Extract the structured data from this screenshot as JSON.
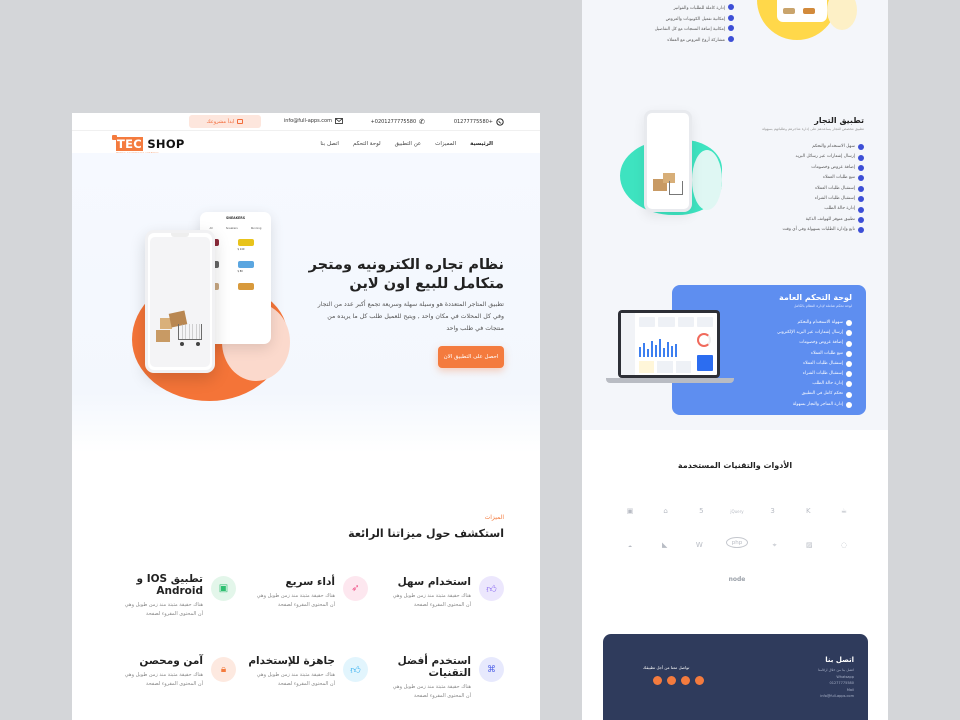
{
  "left": {
    "topbar": {
      "whatsapp": "01277775580+",
      "phone": "+0201277775580",
      "email": "info@full-apps.com",
      "apply_badge": "ابدأ مشروعك"
    },
    "logo": {
      "main": "TEC SHOP",
      "tag": "Online ecommerce solutions"
    },
    "nav": [
      "الرئيسية",
      "المميزات",
      "عن التطبيق",
      "لوحة التحكم",
      "اتصل بنا"
    ],
    "hero": {
      "title_line1": "نظام تجاره الكترونيه ومتجر",
      "title_line2": "متكامل للبيع اون لاين",
      "desc_line1": "تطبيق المتاجر المتعددة هو وسيلة سهلة وسريعة تجمع أكبر عدد من التجار",
      "desc_line2": "وفي كل المحلات في مكان واحد , ويتيح للعميل طلب كل ما يريده من",
      "desc_line3": "منتجات في طلب واحد",
      "cta": "احصل على التطبيق الان"
    },
    "phone_app": {
      "title": "SNEAKERS",
      "tabs": [
        "All",
        "Sneakers",
        "Running"
      ],
      "prices": [
        "$ 180",
        "$ 140",
        "$ 150",
        "$ 80"
      ]
    },
    "features": {
      "kicker": "الميزات",
      "title": "استكشف حول ميزاتنا الرائعة",
      "desc1": "هناك حقيقة مثبتة منذ زمن طويل وهي",
      "desc2": "أن المحتوى المقروء لصفحة",
      "items": [
        {
          "title": "استخدام سهل",
          "icon": "thumbs-up-icon"
        },
        {
          "title": "أداء سريع",
          "icon": "rocket-icon"
        },
        {
          "title_l1": "تطبيق IOS و",
          "title_l2": "Android",
          "icon": "android-icon"
        },
        {
          "title_l1": "استخدم أفضل",
          "title_l2": "التقنيات",
          "icon": "code-icon"
        },
        {
          "title": "جاهزة للإستخدام",
          "icon": "like-icon"
        },
        {
          "title": "آمن ومحصن",
          "icon": "lock-icon"
        }
      ]
    }
  },
  "right": {
    "top_list": [
      "إدارة كاملة للطلبات والفواتير",
      "إمكانية تفعيل الكوبونات والعروض",
      "إمكانية إضافة المنتجات مع كل التفاصيل",
      "مشاركة أروع العروض مع العملاء"
    ],
    "merchant": {
      "title": "تطبيق التجار",
      "subtitle": "تطبيق مخصص للتجار يساعدهم على إدارة متاجرهم وطلباتهم بسهولة",
      "items": [
        "سهل الاستخدام والتحكم",
        "إرسال إشعارات عبر رسائل البريد",
        "إضافة عروض وخصومات",
        "تتبع طلبات العملاء",
        "إستقبال طلبات العملاء",
        "إستقبال طلبات الشراء",
        "إدارة حالة الطلب",
        "تطبيق متوفر للهواتف الذكية",
        "تابع وإدارة الطلبات بسهولة وفي أي وقت"
      ]
    },
    "dashboard": {
      "title": "لوحة التحكم العامة",
      "subtitle": "لوحة تحكم شاملة لإدارة النظام بالكامل",
      "items": [
        "سهولة الاستخدام والتحكم",
        "إرسال إشعارات عبر البريد الإلكتروني",
        "إضافة عروض وخصومات",
        "تتبع طلبات العملاء",
        "إستقبال طلبات العملاء",
        "إستقبال طلبات الشراء",
        "إدارة حالة الطلب",
        "تحكم كامل في التطبيق",
        "إدارة المتاجر والتجار بسهولة"
      ]
    },
    "tools": {
      "title": "الأدوات والتقنيات المستخدمة",
      "labels": [
        "php",
        "node",
        "jQuery"
      ]
    },
    "contact": {
      "title": "اتصل بنا",
      "cta": "تواصل معنا من أجل تطبيقك",
      "lines": [
        "اتصل بنا من خلال ارقامنا",
        "Whatsapp",
        "01277775580",
        "Mail",
        "info@full-apps.com"
      ]
    }
  },
  "colors": {
    "accent": "#f47b3e",
    "blue": "#3d4fd6",
    "mint": "#3ee3c0",
    "dark": "#2f3b5c"
  }
}
